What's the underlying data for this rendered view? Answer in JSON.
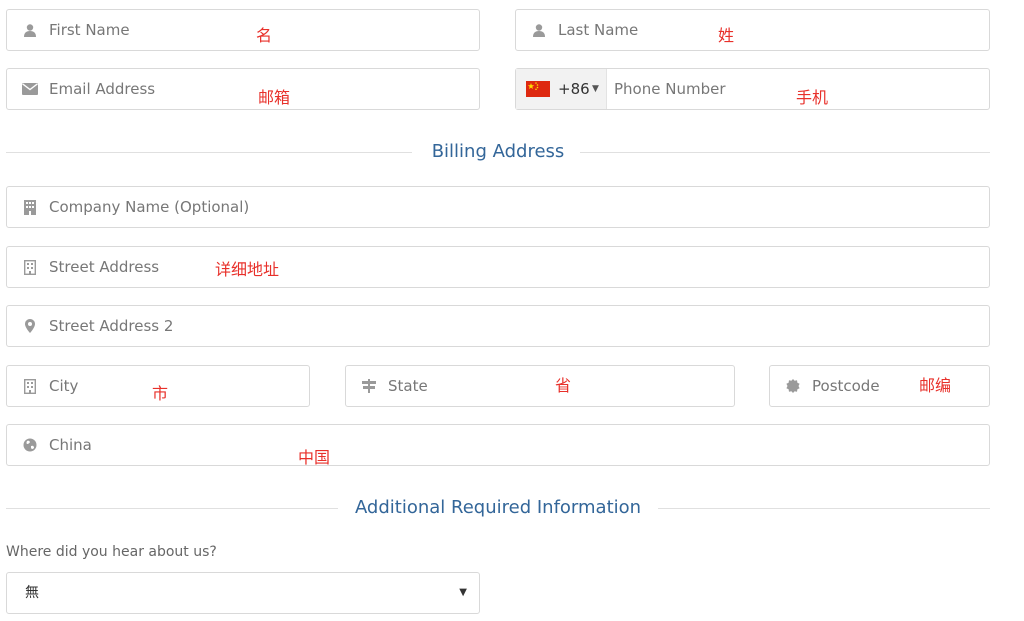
{
  "contact": {
    "first_name_placeholder": "First Name",
    "last_name_placeholder": "Last Name",
    "email_placeholder": "Email Address",
    "phone": {
      "dial_code": "+86",
      "placeholder": "Phone Number",
      "country_flag": "cn-flag-icon"
    }
  },
  "billing": {
    "title": "Billing Address",
    "company_placeholder": "Company Name (Optional)",
    "street_placeholder": "Street Address",
    "street2_placeholder": "Street Address 2",
    "city_placeholder": "City",
    "state_placeholder": "State",
    "postcode_placeholder": "Postcode",
    "country_value": "China"
  },
  "additional": {
    "title": "Additional Required Information",
    "question": "Where did you hear about us?",
    "selected_option": "無"
  },
  "annotations": {
    "first_name": "名",
    "last_name": "姓",
    "email": "邮箱",
    "phone": "手机",
    "street": "详细地址",
    "city": "市",
    "state": "省",
    "postcode": "邮编",
    "country": "中国"
  },
  "colors": {
    "accent": "#336699",
    "annotation": "#e8302a",
    "border": "#d9d9d9",
    "icon": "#9a9a9a"
  }
}
